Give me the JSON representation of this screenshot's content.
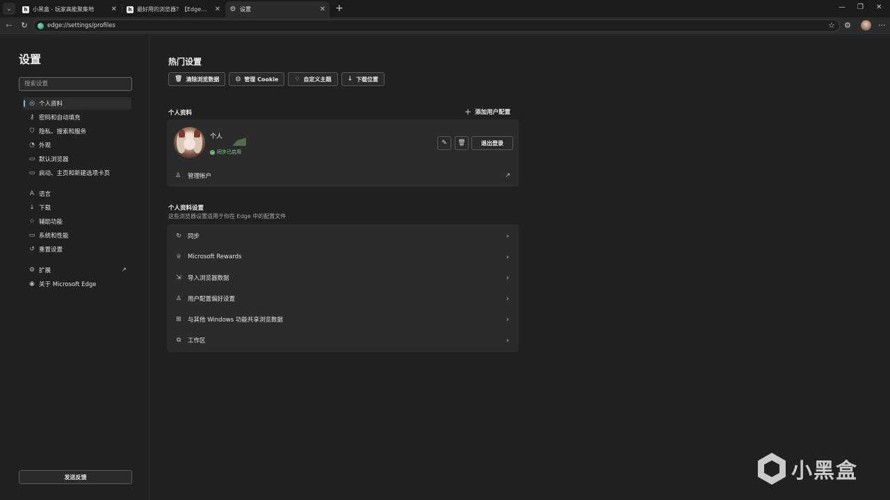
{
  "tabs": [
    {
      "title": "小黑盒 - 玩家高能聚集地",
      "favicon": "h"
    },
    {
      "title": "最好用的浏览器？【Edge】完全使用指南",
      "favicon": "h"
    },
    {
      "title": "设置",
      "favicon": "gear-icon"
    }
  ],
  "address": {
    "url": "edge://settings/profiles"
  },
  "sidebar": {
    "title": "设置",
    "search_placeholder": "搜索设置",
    "items": [
      {
        "label": "个人资料"
      },
      {
        "label": "密码和自动填充"
      },
      {
        "label": "隐私、搜索和服务"
      },
      {
        "label": "外观"
      },
      {
        "label": "默认浏览器"
      },
      {
        "label": "启动、主页和新建选项卡页"
      },
      {
        "label": "语言"
      },
      {
        "label": "下载"
      },
      {
        "label": "辅助功能"
      },
      {
        "label": "系统和性能"
      },
      {
        "label": "重置设置"
      },
      {
        "label": "扩展"
      },
      {
        "label": "关于 Microsoft Edge"
      }
    ],
    "feedback_label": "发送反馈"
  },
  "main": {
    "hot_title": "热门设置",
    "quick": [
      {
        "label": "清除浏览数据"
      },
      {
        "label": "管理 Cookie"
      },
      {
        "label": "自定义主题"
      },
      {
        "label": "下载位置"
      }
    ],
    "profiles_label": "个人资料",
    "add_profile_label": "添加用户配置",
    "profile": {
      "name": "个人",
      "sync_status": "同步已启用",
      "signout_label": "退出登录",
      "manage_label": "管理帐户"
    },
    "profile_settings_title": "个人资料设置",
    "profile_settings_desc": "这些浏览器设置适用于你在 Edge 中的配置文件",
    "rows": [
      {
        "label": "同步"
      },
      {
        "label": "Microsoft Rewards"
      },
      {
        "label": "导入浏览器数据"
      },
      {
        "label": "用户配置偏好设置"
      },
      {
        "label": "与其他 Windows 功能共享浏览数据"
      },
      {
        "label": "工作区"
      }
    ]
  },
  "watermark": {
    "text": "小黑盒"
  },
  "colors": {
    "accent": "#7fb2ea",
    "sync_ok": "#6cc06c",
    "background": "#202020",
    "card": "#2b2b2b"
  }
}
